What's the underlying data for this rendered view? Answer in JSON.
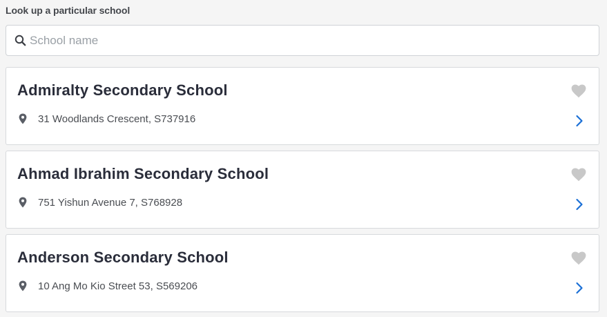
{
  "header": {
    "label": "Look up a particular school"
  },
  "search": {
    "placeholder": "School name",
    "value": ""
  },
  "schools": [
    {
      "name": "Admiralty Secondary School",
      "address": "31 Woodlands Crescent, S737916"
    },
    {
      "name": "Ahmad Ibrahim Secondary School",
      "address": "751 Yishun Avenue 7, S768928"
    },
    {
      "name": "Anderson Secondary School",
      "address": "10 Ang Mo Kio Street 53, S569206"
    }
  ],
  "colors": {
    "title": "#2a2d3a",
    "accent_chevron": "#1a6fd6",
    "heart_inactive": "#c8c8c8",
    "pin": "#5a5e66"
  },
  "icons": {
    "search": "search-icon",
    "pin": "map-pin-icon",
    "favorite": "heart-icon",
    "open": "chevron-right-icon"
  }
}
